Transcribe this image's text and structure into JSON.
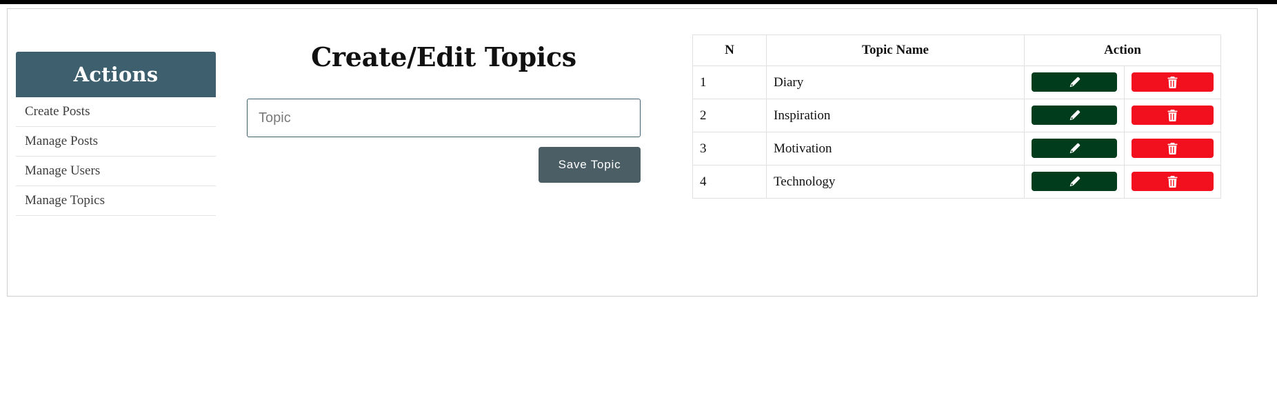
{
  "sidebar": {
    "title": "Actions",
    "items": [
      {
        "label": "Create Posts"
      },
      {
        "label": "Manage Posts"
      },
      {
        "label": "Manage Users"
      },
      {
        "label": "Manage Topics"
      }
    ]
  },
  "form": {
    "title": "Create/Edit Topics",
    "input_placeholder": "Topic",
    "input_value": "",
    "save_label": "Save Topic"
  },
  "table": {
    "headers": {
      "n": "N",
      "name": "Topic Name",
      "action": "Action"
    },
    "rows": [
      {
        "n": "1",
        "name": "Diary"
      },
      {
        "n": "2",
        "name": "Inspiration"
      },
      {
        "n": "3",
        "name": "Motivation"
      },
      {
        "n": "4",
        "name": "Technology"
      }
    ]
  },
  "icons": {
    "edit": "pencil-icon",
    "delete": "trash-icon"
  },
  "colors": {
    "sidebar_header": "#3e5f6e",
    "save_button": "#4b5e66",
    "edit_button": "#013d1c",
    "delete_button": "#f2101e"
  }
}
